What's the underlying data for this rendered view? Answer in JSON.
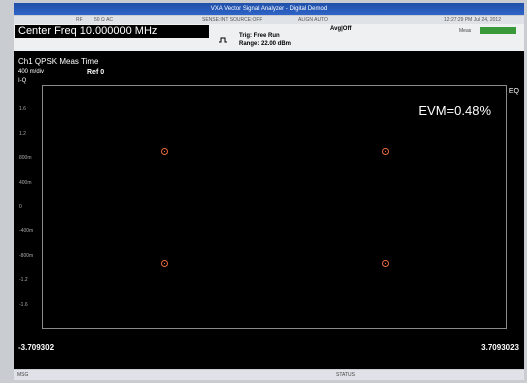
{
  "window": {
    "title": "VXA Vector Signal Analyzer - Digital Demod"
  },
  "strip": {
    "rf": "RF",
    "coupling": "50 Ω  AC",
    "sense": "SENSE:INT  SOURCE:OFF",
    "align": "ALIGN AUTO",
    "time": "12:27:29 PM Jul 24, 2012",
    "meas_label": "Meas"
  },
  "header": {
    "center_freq": "Center Freq 10.000000 MHz",
    "trig": "Trig: Free Run",
    "range": "Range: 22.00 dBm",
    "avg": "Avg|Off"
  },
  "trace": {
    "title": "Ch1 QPSK Meas Time",
    "scale": "400 m/div",
    "ref": "Ref 0",
    "iq": "I-Q",
    "eq": "EQ",
    "evm": "EVM=0.48%"
  },
  "y_ticks": [
    "1.6",
    "1.2",
    "800m",
    "400m",
    "0",
    "-400m",
    "-800m",
    "-1.2",
    "-1.6"
  ],
  "x_axis": {
    "left": "-3.709302",
    "right": "3.7093023"
  },
  "status": {
    "msg": "MSG",
    "status": "STATUS"
  },
  "constellation": [
    {
      "i": -0.707,
      "q": 0.707
    },
    {
      "i": 0.707,
      "q": 0.707
    },
    {
      "i": -0.707,
      "q": -0.707
    },
    {
      "i": 0.707,
      "q": -0.707
    }
  ],
  "colors": {
    "point": "#e86a3a",
    "title_bar": "#1f4fa8"
  }
}
